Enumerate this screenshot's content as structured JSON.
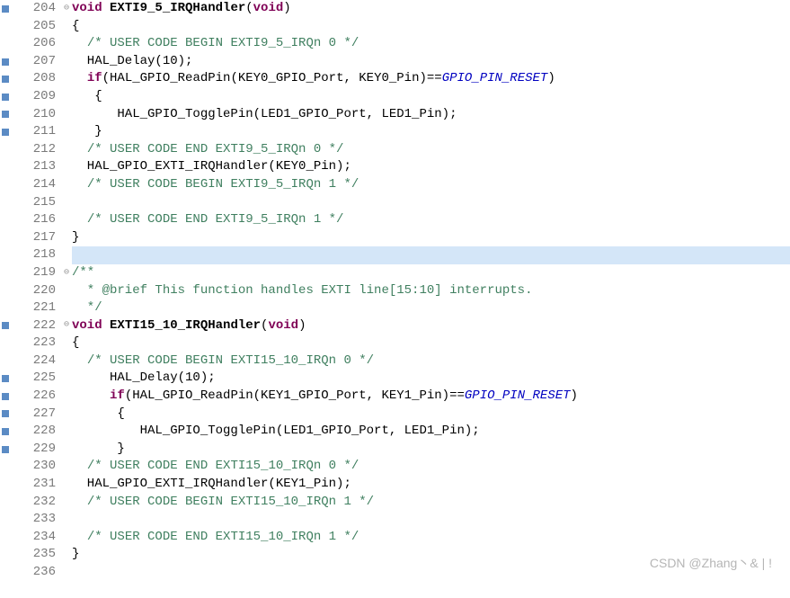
{
  "watermark": "CSDN @Zhang丶& |  !",
  "lines": [
    {
      "num": 204,
      "marker": "blue",
      "fold": "⊖",
      "tokens": [
        {
          "t": "kw",
          "v": "void "
        },
        {
          "t": "fn",
          "v": "EXTI9_5_IRQHandler"
        },
        {
          "t": "paren",
          "v": "("
        },
        {
          "t": "kw",
          "v": "void"
        },
        {
          "t": "paren",
          "v": ")"
        }
      ]
    },
    {
      "num": 205,
      "marker": "",
      "fold": "",
      "tokens": [
        {
          "t": "id",
          "v": "{"
        }
      ]
    },
    {
      "num": 206,
      "marker": "",
      "fold": "",
      "tokens": [
        {
          "t": "id",
          "v": "  "
        },
        {
          "t": "cm",
          "v": "/* USER CODE BEGIN EXTI9_5_IRQn 0 */"
        }
      ]
    },
    {
      "num": 207,
      "marker": "blue",
      "fold": "",
      "tokens": [
        {
          "t": "id",
          "v": "  HAL_Delay(10);"
        }
      ]
    },
    {
      "num": 208,
      "marker": "blue",
      "fold": "",
      "tokens": [
        {
          "t": "id",
          "v": "  "
        },
        {
          "t": "kw",
          "v": "if"
        },
        {
          "t": "id",
          "v": "(HAL_GPIO_ReadPin(KEY0_GPIO_Port, KEY0_Pin)=="
        },
        {
          "t": "macro",
          "v": "GPIO_PIN_RESET"
        },
        {
          "t": "id",
          "v": ")"
        }
      ]
    },
    {
      "num": 209,
      "marker": "blue",
      "fold": "",
      "tokens": [
        {
          "t": "id",
          "v": "   {"
        }
      ]
    },
    {
      "num": 210,
      "marker": "blue",
      "fold": "",
      "tokens": [
        {
          "t": "id",
          "v": "      HAL_GPIO_TogglePin(LED1_GPIO_Port, LED1_Pin);"
        }
      ]
    },
    {
      "num": 211,
      "marker": "blue",
      "fold": "",
      "tokens": [
        {
          "t": "id",
          "v": "   }"
        }
      ]
    },
    {
      "num": 212,
      "marker": "",
      "fold": "",
      "tokens": [
        {
          "t": "id",
          "v": "  "
        },
        {
          "t": "cm",
          "v": "/* USER CODE END EXTI9_5_IRQn 0 */"
        }
      ]
    },
    {
      "num": 213,
      "marker": "",
      "fold": "",
      "tokens": [
        {
          "t": "id",
          "v": "  HAL_GPIO_EXTI_IRQHandler(KEY0_Pin);"
        }
      ]
    },
    {
      "num": 214,
      "marker": "",
      "fold": "",
      "tokens": [
        {
          "t": "id",
          "v": "  "
        },
        {
          "t": "cm",
          "v": "/* USER CODE BEGIN EXTI9_5_IRQn 1 */"
        }
      ]
    },
    {
      "num": 215,
      "marker": "",
      "fold": "",
      "tokens": []
    },
    {
      "num": 216,
      "marker": "",
      "fold": "",
      "tokens": [
        {
          "t": "id",
          "v": "  "
        },
        {
          "t": "cm",
          "v": "/* USER CODE END EXTI9_5_IRQn 1 */"
        }
      ]
    },
    {
      "num": 217,
      "marker": "",
      "fold": "",
      "tokens": [
        {
          "t": "id",
          "v": "}"
        }
      ]
    },
    {
      "num": 218,
      "marker": "",
      "fold": "",
      "highlight": true,
      "tokens": []
    },
    {
      "num": 219,
      "marker": "",
      "fold": "⊖",
      "tokens": [
        {
          "t": "cm",
          "v": "/**"
        }
      ]
    },
    {
      "num": 220,
      "marker": "",
      "fold": "",
      "tokens": [
        {
          "t": "cm",
          "v": "  * @brief This function handles EXTI line[15:10] interrupts."
        }
      ]
    },
    {
      "num": 221,
      "marker": "",
      "fold": "",
      "tokens": [
        {
          "t": "cm",
          "v": "  */"
        }
      ]
    },
    {
      "num": 222,
      "marker": "blue",
      "fold": "⊖",
      "tokens": [
        {
          "t": "kw",
          "v": "void "
        },
        {
          "t": "fn",
          "v": "EXTI15_10_IRQHandler"
        },
        {
          "t": "paren",
          "v": "("
        },
        {
          "t": "kw",
          "v": "void"
        },
        {
          "t": "paren",
          "v": ")"
        }
      ]
    },
    {
      "num": 223,
      "marker": "",
      "fold": "",
      "tokens": [
        {
          "t": "id",
          "v": "{"
        }
      ]
    },
    {
      "num": 224,
      "marker": "",
      "fold": "",
      "tokens": [
        {
          "t": "id",
          "v": "  "
        },
        {
          "t": "cm",
          "v": "/* USER CODE BEGIN EXTI15_10_IRQn 0 */"
        }
      ]
    },
    {
      "num": 225,
      "marker": "blue",
      "fold": "",
      "tokens": [
        {
          "t": "id",
          "v": "     HAL_Delay(10);"
        }
      ]
    },
    {
      "num": 226,
      "marker": "blue",
      "fold": "",
      "tokens": [
        {
          "t": "id",
          "v": "     "
        },
        {
          "t": "kw",
          "v": "if"
        },
        {
          "t": "id",
          "v": "(HAL_GPIO_ReadPin(KEY1_GPIO_Port, KEY1_Pin)=="
        },
        {
          "t": "macro",
          "v": "GPIO_PIN_RESET"
        },
        {
          "t": "id",
          "v": ")"
        }
      ]
    },
    {
      "num": 227,
      "marker": "blue",
      "fold": "",
      "tokens": [
        {
          "t": "id",
          "v": "      {"
        }
      ]
    },
    {
      "num": 228,
      "marker": "blue",
      "fold": "",
      "tokens": [
        {
          "t": "id",
          "v": "         HAL_GPIO_TogglePin(LED1_GPIO_Port, LED1_Pin);"
        }
      ]
    },
    {
      "num": 229,
      "marker": "blue",
      "fold": "",
      "tokens": [
        {
          "t": "id",
          "v": "      }"
        }
      ]
    },
    {
      "num": 230,
      "marker": "",
      "fold": "",
      "tokens": [
        {
          "t": "id",
          "v": "  "
        },
        {
          "t": "cm",
          "v": "/* USER CODE END EXTI15_10_IRQn 0 */"
        }
      ]
    },
    {
      "num": 231,
      "marker": "",
      "fold": "",
      "tokens": [
        {
          "t": "id",
          "v": "  HAL_GPIO_EXTI_IRQHandler(KEY1_Pin);"
        }
      ]
    },
    {
      "num": 232,
      "marker": "",
      "fold": "",
      "tokens": [
        {
          "t": "id",
          "v": "  "
        },
        {
          "t": "cm",
          "v": "/* USER CODE BEGIN EXTI15_10_IRQn 1 */"
        }
      ]
    },
    {
      "num": 233,
      "marker": "",
      "fold": "",
      "tokens": []
    },
    {
      "num": 234,
      "marker": "",
      "fold": "",
      "tokens": [
        {
          "t": "id",
          "v": "  "
        },
        {
          "t": "cm",
          "v": "/* USER CODE END EXTI15_10_IRQn 1 */"
        }
      ]
    },
    {
      "num": 235,
      "marker": "",
      "fold": "",
      "tokens": [
        {
          "t": "id",
          "v": "}"
        }
      ]
    },
    {
      "num": 236,
      "marker": "",
      "fold": "",
      "tokens": []
    }
  ]
}
